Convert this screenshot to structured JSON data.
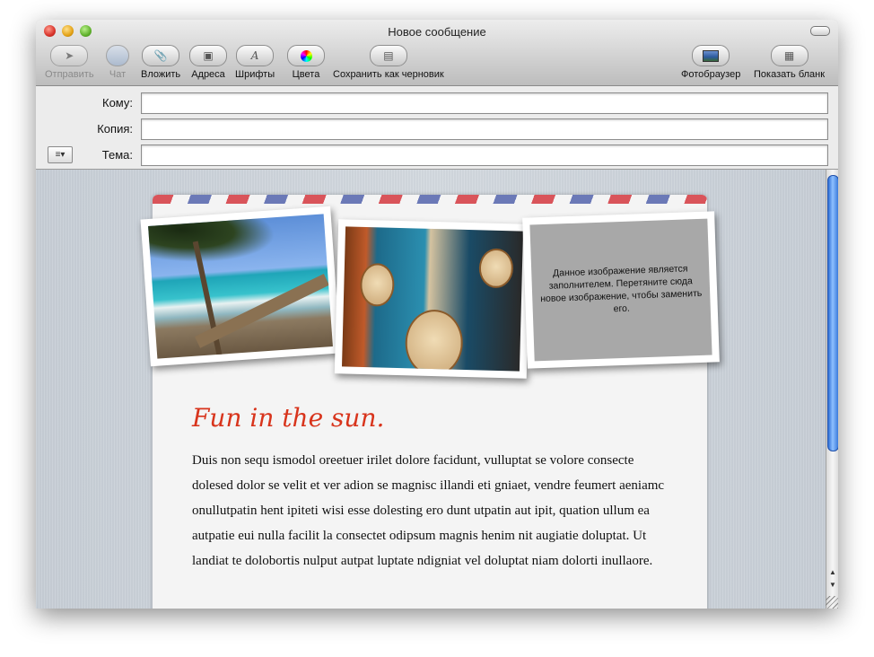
{
  "window": {
    "title": "Новое сообщение"
  },
  "toolbar": {
    "send": "Отправить",
    "chat": "Чат",
    "attach": "Вложить",
    "addresses": "Адреса",
    "fonts": "Шрифты",
    "colors": "Цвета",
    "save_draft": "Сохранить как черновик",
    "photo_browser": "Фотобраузер",
    "show_stationery": "Показать бланк"
  },
  "headers": {
    "to_label": "Кому:",
    "cc_label": "Копия:",
    "subject_label": "Тема:",
    "to_value": "",
    "cc_value": "",
    "subject_value": ""
  },
  "message": {
    "placeholder_text": "Данное изображение является заполнителем. Перетяните сюда новое изображение, чтобы заменить его.",
    "headline": "Fun in the sun.",
    "body": "Duis non sequ ismodol oreetuer irilet dolore facidunt, vulluptat se volore consecte dolesed dolor se velit et ver adion se magnisc illandi eti gniaet, vendre feumert aeniamc onullutpatin hent ipiteti wisi esse dolesting ero dunt utpatin aut ipit, quation ullum ea autpatie eui nulla facilit la consectet odipsum magnis henim nit augiatie doluptat. Ut landiat te dolobortis nulput autpat luptate ndigniat vel doluptat niam dolorti inullaore."
  },
  "icons": [
    "send-icon",
    "chat-icon",
    "paperclip-icon",
    "address-book-icon",
    "fonts-icon",
    "color-wheel-icon",
    "draft-icon",
    "photo-browser-icon",
    "stationery-icon",
    "account-menu-icon"
  ],
  "colors": {
    "headline": "#d8341c",
    "scroll_thumb": "#3a7bdc"
  }
}
